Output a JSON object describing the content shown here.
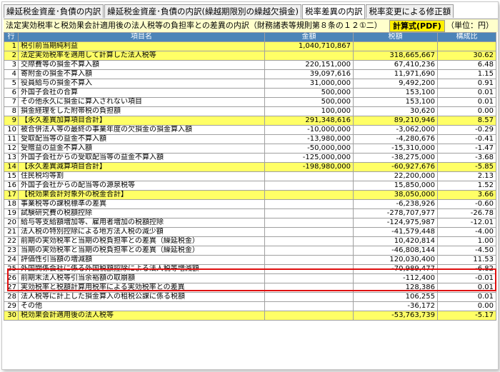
{
  "tabs": [
    {
      "label": "繰延税金資産･負債の内訳",
      "active": false
    },
    {
      "label": "繰延税金資産･負債の内訳(繰越期限別の繰越欠損金)",
      "active": false
    },
    {
      "label": "税率差異の内訳",
      "active": true
    },
    {
      "label": "税率変更による修正額",
      "active": false
    }
  ],
  "subbar": {
    "description": "法定実効税率と税効果会計適用後の法人税等の負担率との差異の内訳（財務諸表等規則第８条の１２①二）",
    "pdf_button": "計算式(PDF)",
    "unit": "（単位：円）"
  },
  "headers": {
    "row": "行",
    "item": "項目名",
    "amount": "金額",
    "tax": "税額",
    "ratio": "構成比"
  },
  "highlight_color": "#ffff66",
  "rows": [
    {
      "no": "1",
      "label": "税引前当期純利益",
      "amount": "1,040,710,867",
      "tax": "",
      "ratio": "",
      "hl": true
    },
    {
      "no": "2",
      "label": "法定実効税率を適用して計算した法人税等",
      "amount": "",
      "tax": "318,665,667",
      "ratio": "30.62",
      "hl": true
    },
    {
      "no": "3",
      "label": "交際費等の損金不算入額",
      "amount": "220,151,000",
      "tax": "67,410,236",
      "ratio": "6.48",
      "hl": false
    },
    {
      "no": "4",
      "label": "寄附金の損金不算入額",
      "amount": "39,097,616",
      "tax": "11,971,690",
      "ratio": "1.15",
      "hl": false
    },
    {
      "no": "5",
      "label": "役員給与の損金不算入",
      "amount": "31,000,000",
      "tax": "9,492,200",
      "ratio": "0.91",
      "hl": false
    },
    {
      "no": "6",
      "label": "外国子会社の合算",
      "amount": "500,000",
      "tax": "153,100",
      "ratio": "0.01",
      "hl": false
    },
    {
      "no": "7",
      "label": "その他永久に損金に算入されない項目",
      "amount": "500,000",
      "tax": "153,100",
      "ratio": "0.01",
      "hl": false
    },
    {
      "no": "8",
      "label": "損金経理をした附帯税の負担額",
      "amount": "100,000",
      "tax": "30,620",
      "ratio": "0.00",
      "hl": false
    },
    {
      "no": "9",
      "label": "【永久差異加算項目合計】",
      "amount": "291,348,616",
      "tax": "89,210,946",
      "ratio": "8.57",
      "hl": true
    },
    {
      "no": "10",
      "label": "被合併法人等の最終の事業年度の欠損金の損金算入額",
      "amount": "-10,000,000",
      "tax": "-3,062,000",
      "ratio": "-0.29",
      "hl": false
    },
    {
      "no": "11",
      "label": "受取配当等の益金不算入額",
      "amount": "-13,980,000",
      "tax": "-4,280,676",
      "ratio": "-0.41",
      "hl": false
    },
    {
      "no": "12",
      "label": "受贈益の益金不算入額",
      "amount": "-50,000,000",
      "tax": "-15,310,000",
      "ratio": "-1.47",
      "hl": false
    },
    {
      "no": "13",
      "label": "外国子会社からの受取配当等の益金不算入額",
      "amount": "-125,000,000",
      "tax": "-38,275,000",
      "ratio": "-3.68",
      "hl": false
    },
    {
      "no": "14",
      "label": "【永久差異減算項目合計】",
      "amount": "-198,980,000",
      "tax": "-60,927,676",
      "ratio": "-5.85",
      "hl": true
    },
    {
      "no": "15",
      "label": "住民税均等割",
      "amount": "",
      "tax": "22,200,000",
      "ratio": "2.13",
      "hl": false
    },
    {
      "no": "16",
      "label": "外国子会社からの配当等の源泉税等",
      "amount": "",
      "tax": "15,850,000",
      "ratio": "1.52",
      "hl": false
    },
    {
      "no": "17",
      "label": "【税効果会計対象外の税金合計】",
      "amount": "",
      "tax": "38,050,000",
      "ratio": "3.66",
      "hl": true
    },
    {
      "no": "18",
      "label": "事業税等の課税標準の差異",
      "amount": "",
      "tax": "-6,238,926",
      "ratio": "-0.60",
      "hl": false
    },
    {
      "no": "19",
      "label": "試験研究費の税額控除",
      "amount": "",
      "tax": "-278,707,977",
      "ratio": "-26.78",
      "hl": false
    },
    {
      "no": "20",
      "label": "給与等支給額増加等、雇用者増加の税額控除",
      "amount": "",
      "tax": "-124,975,987",
      "ratio": "-12.01",
      "hl": false
    },
    {
      "no": "21",
      "label": "法人税の特別控除による地方法人税の減少額",
      "amount": "",
      "tax": "-41,579,448",
      "ratio": "-4.00",
      "hl": false
    },
    {
      "no": "22",
      "label": "前期の実効税率と当期の税負担率との差異（繰延税金）",
      "amount": "",
      "tax": "10,420,814",
      "ratio": "1.00",
      "hl": false
    },
    {
      "no": "23",
      "label": "当期の実効税率と当期の税負担率との差異（繰延税金）",
      "amount": "",
      "tax": "-46,808,144",
      "ratio": "-4.50",
      "hl": false
    },
    {
      "no": "24",
      "label": "評価性引当額の増減額",
      "amount": "",
      "tax": "120,030,400",
      "ratio": "11.53",
      "hl": false
    },
    {
      "no": "25",
      "label": "外国関係会社に係る外国税額控除による法人税等増減額",
      "amount": "",
      "tax": "-70,989,477",
      "ratio": "-6.82",
      "hl": false
    },
    {
      "no": "26",
      "label": "前期末法人税等引当余裕額の取崩額",
      "amount": "",
      "tax": "-112,400",
      "ratio": "-0.01",
      "hl": false
    },
    {
      "no": "27",
      "label": "実効税率と税額計算用税率による実効税率との差異",
      "amount": "",
      "tax": "128,386",
      "ratio": "0.01",
      "hl": false
    },
    {
      "no": "28",
      "label": "法人税等に計上した損金算入の租税公課に係る税額",
      "amount": "",
      "tax": "106,255",
      "ratio": "0.01",
      "hl": false
    },
    {
      "no": "29",
      "label": "その他",
      "amount": "",
      "tax": "-36,172",
      "ratio": "0.00",
      "hl": false
    },
    {
      "no": "30",
      "label": "税効果会計適用後の法人税等",
      "amount": "",
      "tax": "-53,763,739",
      "ratio": "-5.17",
      "hl": true
    }
  ]
}
